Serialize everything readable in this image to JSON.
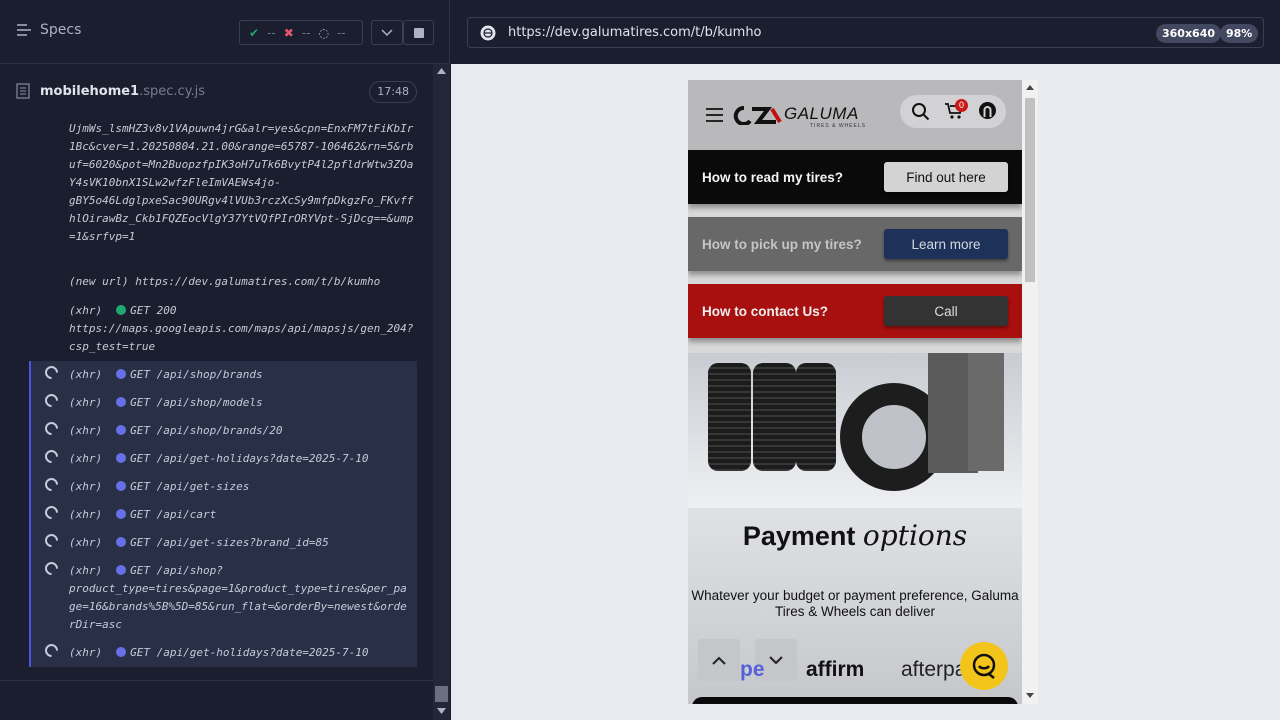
{
  "runner": {
    "specs_label": "Specs",
    "passed": "--",
    "failed": "--",
    "pending": "--",
    "spec_file": "mobilehome1",
    "spec_ext": ".spec.cy.js",
    "duration": "17:48"
  },
  "log": {
    "query_text": "UjmWs_lsmHZ3v8v1VApuwn4jrG&alr=yes&cpn=EnxFM7tFiKbIr1Bc&cver=1.20250804.21.00&range=65787-106462&rn=5&rbuf=6020&pot=Mn2BuopzfpIK3oH7uTk6BvytP4l2pfldrWtw3ZOaY4sVK10bnX1SLw2wfzFleImVAEWs4jo-\ngBY5o46LdglpxeSac90URgv4lVUb3rczXcSy9mfpDkgzFo_FKvffhlOirawBz_Ckb1FQZEocVlgY37YtVQfPIrORYVpt-SjDcg==&ump=1&srfvp=1",
    "new_url_label": "(new url)",
    "new_url": "https://dev.galumatires.com/t/b/kumho",
    "xhr_done": {
      "type": "(xhr)",
      "method": "GET 200",
      "url": "https://maps.googleapis.com/maps/api/mapsjs/gen_204?csp_test=true"
    },
    "pending": [
      {
        "type": "(xhr)",
        "text": "GET /api/shop/brands"
      },
      {
        "type": "(xhr)",
        "text": "GET /api/shop/models"
      },
      {
        "type": "(xhr)",
        "text": "GET /api/shop/brands/20"
      },
      {
        "type": "(xhr)",
        "text": "GET /api/get-holidays?date=2025-7-10"
      },
      {
        "type": "(xhr)",
        "text": "GET /api/get-sizes"
      },
      {
        "type": "(xhr)",
        "text": "GET /api/cart"
      },
      {
        "type": "(xhr)",
        "text": "GET /api/get-sizes?brand_id=85"
      },
      {
        "type": "(xhr)",
        "text": "GET /api/shop?"
      },
      {
        "type": "(xhr)",
        "text": "GET /api/get-holidays?date=2025-7-10"
      }
    ],
    "shop_cont": "product_type=tires&page=1&product_type=tires&per_page=16&brands%5B%5D=85&run_flat=&orderBy=newest&orderDir=asc"
  },
  "aut": {
    "url": "https://dev.galumatires.com/t/b/kumho",
    "viewport": "360x640",
    "zoom": "98%"
  },
  "site": {
    "logo_text": "GALUMA",
    "logo_sub": "TIRES & WHEELS",
    "cart_count": "0",
    "banners": [
      {
        "q": "How to read my tires?",
        "btn": "Find out here"
      },
      {
        "q": "How to pick up my tires?",
        "btn": "Learn more"
      },
      {
        "q": "How to contact Us?",
        "btn": "Call"
      }
    ],
    "pay_title": "Payment",
    "pay_script": "options",
    "pay_sub": "Whatever your budget or payment preference, Galuma Tires & Wheels can deliver",
    "partners": [
      "pe",
      "affirm",
      "afterpa"
    ]
  },
  "colors": {
    "pass": "#1fa971",
    "fail": "#e45770",
    "xhr_pending": "#6770e8",
    "brand_red": "#a80f0f",
    "brand_navy": "#1e3158",
    "chat_yellow": "#f3c419"
  }
}
